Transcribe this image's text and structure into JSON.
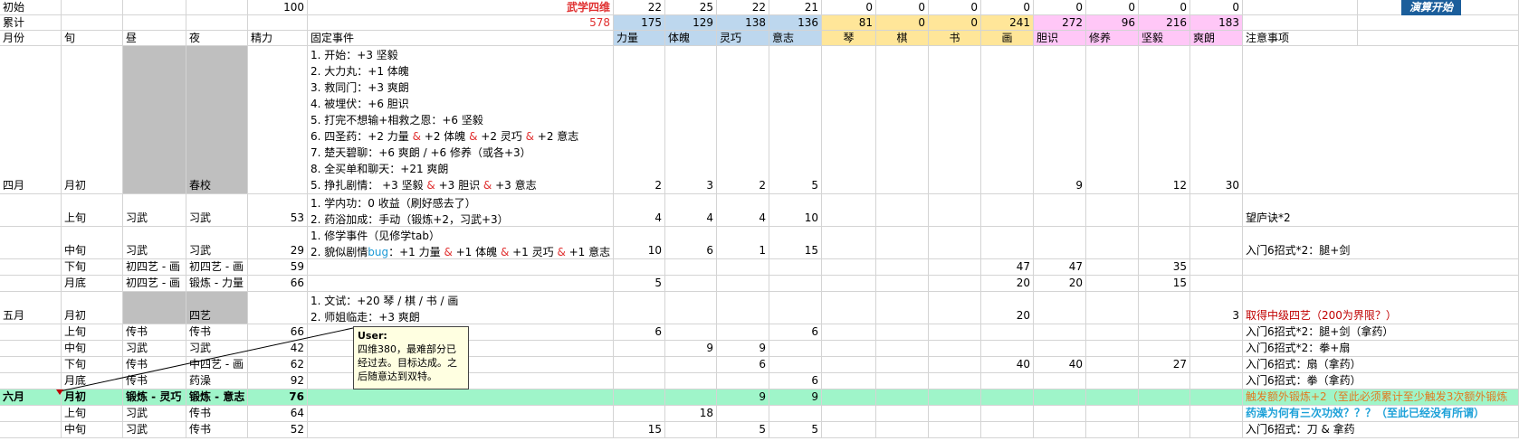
{
  "cols": {
    "label": "月份",
    "xun": "旬",
    "day": "昼",
    "night": "夜",
    "jingli": "精力",
    "fixed": "固定事件",
    "liliang": "力量",
    "tipo": "体魄",
    "lingqiao": "灵巧",
    "yizhi": "意志",
    "qin": "琴",
    "qi": "棋",
    "shu": "书",
    "hua": "画",
    "danshi": "胆识",
    "xiuyang": "修养",
    "jianyi": "坚毅",
    "shuanglang": "爽朗",
    "notes": "注意事项"
  },
  "row_init": {
    "label": "初始",
    "jingli": "100",
    "wuxue": "武学四维",
    "v": [
      "22",
      "25",
      "22",
      "21",
      "0",
      "0",
      "0",
      "0",
      "0",
      "0",
      "0",
      "0"
    ],
    "button": "演算开始"
  },
  "row_sum": {
    "label": "累计",
    "total": "578",
    "v": [
      "175",
      "129",
      "138",
      "136",
      "81",
      "0",
      "0",
      "241",
      "272",
      "96",
      "216",
      "183"
    ]
  },
  "rows": [
    {
      "month": "四月",
      "xun": "月初",
      "day": "",
      "night": "春校",
      "jingli": "",
      "events": [
        {
          "parts": [
            [
              "1. 开始：+3 坚毅",
              ""
            ]
          ]
        },
        {
          "parts": [
            [
              "2. 大力丸：+1 体魄",
              ""
            ]
          ]
        },
        {
          "parts": [
            [
              "3. 救同门：+3 爽朗",
              ""
            ]
          ]
        },
        {
          "parts": [
            [
              "4. 被埋伏：+6 胆识",
              ""
            ]
          ]
        },
        {
          "parts": [
            [
              "5. 打完不想输+相救之恩：+6 坚毅",
              ""
            ]
          ]
        },
        {
          "parts": [
            [
              "6. 四圣药：+2 力量 ",
              ""
            ],
            [
              "&",
              "red"
            ],
            [
              " +2 体魄 ",
              ""
            ],
            [
              "&",
              "red"
            ],
            [
              " +2 灵巧 ",
              ""
            ],
            [
              "&",
              "red"
            ],
            [
              " +2 意志",
              ""
            ]
          ]
        },
        {
          "parts": [
            [
              "7. 楚天碧聊：+6 爽朗 / +6 修养（或各+3）",
              ""
            ]
          ]
        },
        {
          "parts": [
            [
              "8. 全买单和聊天：+21 爽朗",
              ""
            ]
          ]
        },
        {
          "parts": [
            [
              "5. 挣扎剧情： +3 坚毅 ",
              ""
            ],
            [
              "&",
              "red"
            ],
            [
              " +3 胆识 ",
              ""
            ],
            [
              "&",
              "red"
            ],
            [
              " +3 意志",
              ""
            ]
          ]
        }
      ],
      "vals": [
        "2",
        "3",
        "2",
        "5",
        "",
        "",
        "",
        "",
        "9",
        "",
        "12",
        "30"
      ],
      "note": "",
      "note_style": ""
    },
    {
      "month": "",
      "xun": "上旬",
      "day": "习武",
      "night": "习武",
      "jingli": "53",
      "events": [
        {
          "parts": [
            [
              "1. 学内功：0 收益（刷好感去了）",
              ""
            ]
          ]
        },
        {
          "parts": [
            [
              "2. 药浴加成：手动（锻炼+2，习武+3）",
              ""
            ]
          ]
        }
      ],
      "vals": [
        "4",
        "4",
        "4",
        "10",
        "",
        "",
        "",
        "",
        "",
        "",
        "",
        ""
      ],
      "note": "望庐诀*2",
      "note_style": ""
    },
    {
      "month": "",
      "xun": "中旬",
      "day": "习武",
      "night": "习武",
      "jingli": "29",
      "events": [
        {
          "parts": [
            [
              "1. 修学事件（见修学tab）",
              ""
            ]
          ]
        },
        {
          "parts": [
            [
              "2. 貌似剧情",
              ""
            ],
            [
              "bug",
              "blue"
            ],
            [
              "：+1 力量 ",
              ""
            ],
            [
              "&",
              "red"
            ],
            [
              " +1 体魄 ",
              ""
            ],
            [
              "&",
              "red"
            ],
            [
              " +1 灵巧 ",
              ""
            ],
            [
              "&",
              "red"
            ],
            [
              " +1 意志",
              ""
            ]
          ]
        }
      ],
      "vals": [
        "10",
        "6",
        "1",
        "15",
        "",
        "",
        "",
        "",
        "",
        "",
        "",
        ""
      ],
      "note": "入门6招式*2：腿+剑",
      "note_style": ""
    },
    {
      "month": "",
      "xun": "下旬",
      "day": "初四艺 - 画",
      "night": "初四艺 - 画",
      "jingli": "59",
      "events": [],
      "vals": [
        "",
        "",
        "",
        "",
        "",
        "",
        "",
        "47",
        "47",
        "",
        "35",
        ""
      ],
      "note": "",
      "note_style": ""
    },
    {
      "month": "",
      "xun": "月底",
      "day": "初四艺 - 画",
      "night": "锻炼 - 力量",
      "jingli": "66",
      "events": [],
      "vals": [
        "5",
        "",
        "",
        "",
        "",
        "",
        "",
        "20",
        "20",
        "",
        "15",
        ""
      ],
      "note": "",
      "note_style": ""
    },
    {
      "month": "五月",
      "xun": "月初",
      "day": "",
      "night": "四艺",
      "jingli": "",
      "events": [
        {
          "parts": [
            [
              "1. 文试：+20 琴 / 棋 / 书 / 画",
              ""
            ]
          ]
        },
        {
          "parts": [
            [
              "2. 师姐临走：+3 爽朗",
              ""
            ]
          ]
        }
      ],
      "vals": [
        "",
        "",
        "",
        "",
        "",
        "",
        "",
        "20",
        "",
        "",
        "",
        "3"
      ],
      "note": "取得中级四艺（200为界限？）",
      "note_style": "red"
    },
    {
      "month": "",
      "xun": "上旬",
      "day": "传书",
      "night": "传书",
      "jingli": "66",
      "events": [],
      "vals": [
        "6",
        "",
        "",
        "6",
        "",
        "",
        "",
        "",
        "",
        "",
        "",
        ""
      ],
      "note": "入门6招式*2：腿+剑（拿药）",
      "note_style": ""
    },
    {
      "month": "",
      "xun": "中旬",
      "day": "习武",
      "night": "习武",
      "jingli": "42",
      "events": [],
      "vals": [
        "",
        "9",
        "9",
        "",
        "",
        "",
        "",
        "",
        "",
        "",
        "",
        ""
      ],
      "note": "入门6招式*2：拳+扇",
      "note_style": ""
    },
    {
      "month": "",
      "xun": "下旬",
      "day": "传书",
      "night": "中四艺 - 画",
      "jingli": "62",
      "events": [],
      "vals": [
        "",
        "",
        "6",
        "",
        "",
        "",
        "",
        "40",
        "40",
        "",
        "27",
        ""
      ],
      "note": "入门6招式：扇（拿药）",
      "note_style": ""
    },
    {
      "month": "",
      "xun": "月底",
      "day": "传书",
      "night": "药澡",
      "jingli": "92",
      "events": [],
      "vals": [
        "",
        "",
        "",
        "6",
        "",
        "",
        "",
        "",
        "",
        "",
        "",
        ""
      ],
      "note": "入门6招式：拳（拿药）",
      "note_style": ""
    },
    {
      "month": "六月",
      "xun": "月初",
      "day": "锻炼 - 灵巧",
      "night": "锻炼 - 意志",
      "jingli": "76",
      "events": [],
      "vals": [
        "",
        "",
        "9",
        "9",
        "",
        "",
        "",
        "",
        "",
        "",
        "",
        ""
      ],
      "note": "触发额外锻炼+2（至此必须累计至少触发3次额外锻炼",
      "note_style": "orange"
    },
    {
      "month": "",
      "xun": "上旬",
      "day": "习武",
      "night": "传书",
      "jingli": "64",
      "events": [],
      "vals": [
        "",
        "18",
        "",
        "",
        "",
        "",
        "",
        "",
        "",
        "",
        "",
        ""
      ],
      "note": "药澡为何有三次功效？？？（至此已经没有所谓）",
      "note_style": "blue"
    },
    {
      "month": "",
      "xun": "中旬",
      "day": "习武",
      "night": "传书",
      "jingli": "52",
      "events": [],
      "vals": [
        "15",
        "",
        "5",
        "5",
        "",
        "",
        "",
        "",
        "",
        "",
        "",
        ""
      ],
      "note": "入门6招式：刀 & 拿药",
      "note_style": ""
    }
  ],
  "comment": {
    "author": "User:",
    "text": "四维380，最难部分已经过去。目标达成。之后随意达到双特。"
  },
  "colors": {
    "wuxue_blue": "#bdd7ee",
    "siyi_yellow": "#ffe699",
    "xingge_pink": "#ffc7f7",
    "highlight_green": "#9ff5c9",
    "gray": "#bfbfbf"
  }
}
